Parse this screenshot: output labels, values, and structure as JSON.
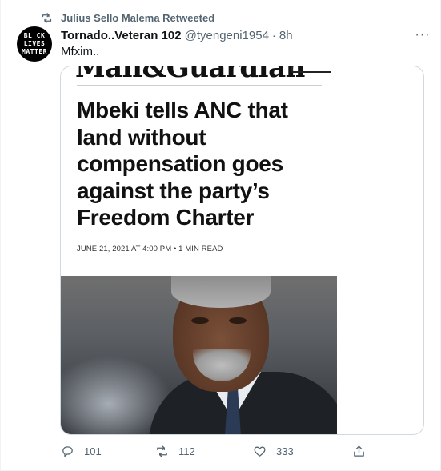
{
  "retweet": {
    "icon": "retweet-icon",
    "label": "Julius Sello Malema Retweeted"
  },
  "author": {
    "avatar_lines": [
      "BL CK",
      "LIVES",
      "MATTER"
    ],
    "name": "Tornado..Veteran 102",
    "handle": "@tyengeni1954",
    "separator": "·",
    "time": "8h"
  },
  "more_icon": "more-icon",
  "more_label": "···",
  "tweet_text": "Mfxim..",
  "media": {
    "masthead": "Mail&Guardian",
    "headline": "Mbeki tells ANC that land without compensation goes against the party’s Freedom Charter",
    "dateline": "JUNE 21, 2021 AT 4:00 PM • 1 MIN READ",
    "photo": "portrait-photo"
  },
  "actions": {
    "reply": {
      "icon": "reply-icon",
      "count": "101"
    },
    "retweet": {
      "icon": "retweet-icon",
      "count": "112"
    },
    "like": {
      "icon": "heart-icon",
      "count": "333"
    },
    "share": {
      "icon": "share-icon"
    }
  },
  "colors": {
    "text_primary": "#0f1419",
    "text_secondary": "#536471",
    "border": "#cfd9de"
  }
}
